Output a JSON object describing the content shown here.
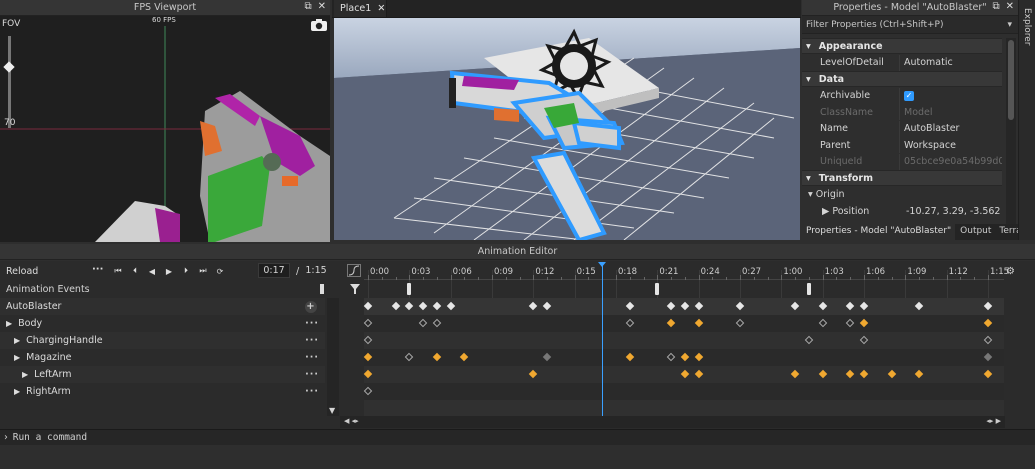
{
  "fps_viewport": {
    "title": "FPS Viewport",
    "fps_label": "60 FPS",
    "fov_label": "FOV",
    "fov_value": "70"
  },
  "place_tab": {
    "label": "Place1"
  },
  "properties": {
    "title": "Properties - Model \"AutoBlaster\"",
    "filter_placeholder": "Filter Properties (Ctrl+Shift+P)",
    "rows": [
      {
        "type": "cat",
        "name": "Appearance"
      },
      {
        "type": "prop",
        "name": "LevelOfDetail",
        "value": "Automatic",
        "dim": false
      },
      {
        "type": "cat",
        "name": "Data"
      },
      {
        "type": "prop",
        "name": "Archivable",
        "value": "",
        "checkbox": true,
        "dim": false
      },
      {
        "type": "prop",
        "name": "ClassName",
        "value": "Model",
        "dim": true
      },
      {
        "type": "prop",
        "name": "Name",
        "value": "AutoBlaster",
        "dim": false
      },
      {
        "type": "prop",
        "name": "Parent",
        "value": "Workspace",
        "dim": false
      },
      {
        "type": "prop",
        "name": "UniqueId",
        "value": "05cbce9e0a54b99d06...",
        "dim": true
      },
      {
        "type": "cat",
        "name": "Transform"
      },
      {
        "type": "sub",
        "name": "Origin",
        "value": ""
      },
      {
        "type": "sub2",
        "name": "Position",
        "value": "-10.27, 3.29, -3.562"
      }
    ],
    "bottom_tabs": [
      "Properties - Model \"AutoBlaster\"",
      "Output",
      "Terra"
    ],
    "explorer_label": "Explorer"
  },
  "animation_editor": {
    "title": "Animation Editor",
    "reload_label": "Reload",
    "current_time": "0:17",
    "separator": "/",
    "end_time": "1:15",
    "events_label": "Animation Events",
    "tree": [
      {
        "name": "AutoBlaster",
        "indent": 0,
        "arrow": false,
        "add": true
      },
      {
        "name": "Body",
        "indent": 0,
        "arrow": true
      },
      {
        "name": "ChargingHandle",
        "indent": 1,
        "arrow": true
      },
      {
        "name": "Magazine",
        "indent": 1,
        "arrow": true
      },
      {
        "name": "LeftArm",
        "indent": 2,
        "arrow": true
      },
      {
        "name": "RightArm",
        "indent": 1,
        "arrow": true
      }
    ],
    "time_labels": [
      "0:00",
      "0:03",
      "0:06",
      "0:09",
      "0:12",
      "0:15",
      "0:18",
      "0:21",
      "0:24",
      "0:27",
      "1:00",
      "1:03",
      "1:06",
      "1:09",
      "1:12",
      "1:15"
    ],
    "playhead_frame": 17,
    "event_markers_frames": [
      3,
      21,
      32
    ],
    "keyframes": [
      {
        "row": 0,
        "frames": [
          0,
          2,
          3,
          4,
          5,
          6,
          12,
          13,
          19,
          22,
          23,
          24,
          27,
          31,
          33,
          35,
          36,
          40,
          45
        ],
        "kind": "w"
      },
      {
        "row": 1,
        "frames": [
          0,
          4,
          5,
          19,
          22,
          24,
          27,
          33,
          35,
          36,
          45
        ],
        "kinds": [
          "g",
          "g",
          "g",
          "g",
          "o",
          "o",
          "g",
          "g",
          "g",
          "o",
          "o"
        ]
      },
      {
        "row": 2,
        "frames": [
          0,
          32,
          36,
          45
        ],
        "kinds": [
          "g",
          "g",
          "g",
          "g"
        ]
      },
      {
        "row": 3,
        "frames": [
          0,
          3,
          5,
          7,
          13,
          19,
          22,
          23,
          24,
          45
        ],
        "kinds": [
          "o",
          "g",
          "o",
          "o",
          "d",
          "o",
          "g",
          "o",
          "o",
          "d"
        ]
      },
      {
        "row": 4,
        "frames": [
          0,
          12,
          23,
          24,
          31,
          33,
          35,
          36,
          38,
          40,
          45
        ],
        "kinds": [
          "o",
          "o",
          "o",
          "o",
          "o",
          "o",
          "o",
          "o",
          "o",
          "o",
          "o"
        ]
      },
      {
        "row": 5,
        "frames": [
          0
        ],
        "kinds": [
          "g"
        ]
      }
    ]
  },
  "command_bar": {
    "placeholder": "Run a command"
  },
  "colors": {
    "selection_blue": "#2f9bff",
    "keyframe_orange": "#f0a830",
    "playhead": "#3aa0ff"
  }
}
